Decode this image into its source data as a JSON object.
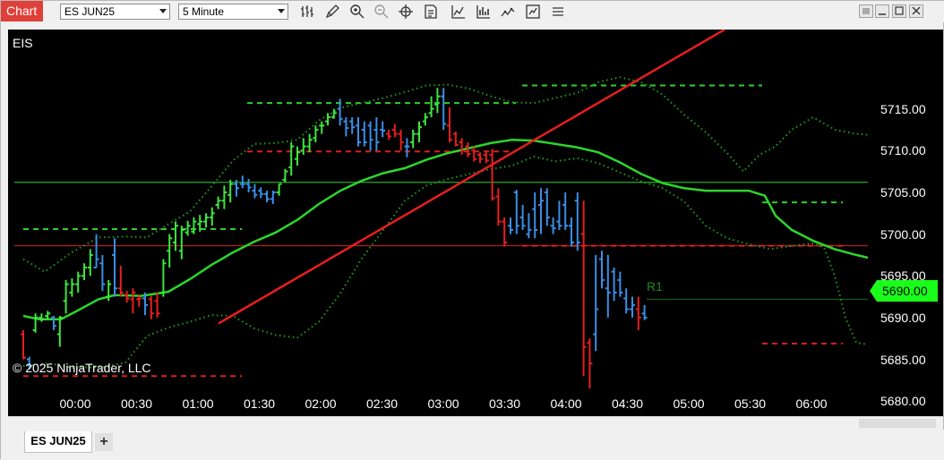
{
  "toolbar": {
    "chart_label": "Chart",
    "instrument_select": "ES JUN25",
    "interval_select": "5 Minute",
    "icons": [
      "bar-style-icon",
      "draw-tool-icon",
      "zoom-in-icon",
      "zoom-out-icon",
      "crosshair-icon",
      "data-box-icon",
      "indicators-icon",
      "strategies-icon",
      "chart-trader-icon",
      "properties-icon",
      "drawing-objects-icon"
    ]
  },
  "window": {
    "buttons": [
      "restore-icon",
      "minimize-icon",
      "maximize-icon",
      "close-icon"
    ]
  },
  "chart": {
    "instrument_label": "EIS",
    "copyright": "© 2025 NinjaTrader, LLC",
    "r1_label": "R1",
    "current_price": "5690.00"
  },
  "colors": {
    "up": "#3de63d",
    "down": "#e61e1e",
    "neutral": "#3a8ee6",
    "sma": "#2cd62c",
    "trendline": "#e61e1e",
    "level_green": "#2bd12b",
    "level_red": "#d92020"
  },
  "tabs": {
    "active": "ES JUN25",
    "add": "+"
  },
  "chart_data": {
    "type": "ohlc",
    "yticks": [
      "5715.00",
      "5710.00",
      "5705.00",
      "5700.00",
      "5695.00",
      "5690.00",
      "5685.00",
      "5680.00"
    ],
    "ytick_values": [
      5715,
      5710,
      5705,
      5700,
      5695,
      5690,
      5685,
      5680
    ],
    "xticks": [
      "00:00",
      "00:30",
      "01:00",
      "01:30",
      "02:00",
      "02:30",
      "03:00",
      "03:30",
      "04:00",
      "04:30",
      "05:00",
      "05:30",
      "06:00"
    ],
    "ylim": [
      5678.2,
      5724.5
    ],
    "xlim": [
      -8.5,
      87.5
    ],
    "bars": [
      [
        5688,
        5688.5,
        5685,
        5685.2,
        "d"
      ],
      [
        5685,
        5685.3,
        5683.8,
        5684.2,
        "n"
      ],
      [
        5688.5,
        5690.5,
        5688.2,
        5690,
        "u"
      ],
      [
        5690,
        5690.5,
        5689.5,
        5689.8,
        "u"
      ],
      [
        5690.2,
        5690.8,
        5689.7,
        5690.5,
        "u"
      ],
      [
        5690,
        5690.2,
        5688.5,
        5689,
        "n"
      ],
      [
        5688,
        5690.2,
        5686.5,
        5690,
        "u"
      ],
      [
        5692,
        5694.5,
        5690.5,
        5694,
        "u"
      ],
      [
        5693,
        5694.7,
        5692.5,
        5694,
        "u"
      ],
      [
        5694,
        5695.5,
        5693,
        5695,
        "u"
      ],
      [
        5695,
        5696.5,
        5694.5,
        5696,
        "u"
      ],
      [
        5696,
        5698.2,
        5695,
        5697.5,
        "u"
      ],
      [
        5696,
        5700,
        5696,
        5697,
        "n"
      ],
      [
        5696.5,
        5697.5,
        5693.2,
        5694,
        "n"
      ],
      [
        5692.5,
        5694.5,
        5692,
        5694,
        "u"
      ],
      [
        5697.5,
        5699.5,
        5692.5,
        5693.5,
        "n"
      ],
      [
        5693.5,
        5696.2,
        5692.5,
        5693,
        "d"
      ],
      [
        5692.7,
        5693.2,
        5691.8,
        5692.3,
        "d"
      ],
      [
        5692.2,
        5693.5,
        5690.5,
        5693,
        "d"
      ],
      [
        5692.2,
        5692.7,
        5691.3,
        5692.3,
        "d"
      ],
      [
        5692.3,
        5693,
        5690.3,
        5691.5,
        "n"
      ],
      [
        5692.2,
        5692.6,
        5689.8,
        5690.5,
        "d"
      ],
      [
        5692,
        5693,
        5690,
        5690.5,
        "d"
      ],
      [
        5693,
        5697,
        5692.5,
        5696.5,
        "u"
      ],
      [
        5698,
        5700,
        5696,
        5699.5,
        "u"
      ],
      [
        5699,
        5701.5,
        5698,
        5701,
        "u"
      ],
      [
        5698,
        5701,
        5697,
        5700.5,
        "u"
      ],
      [
        5700.2,
        5701.6,
        5699.8,
        5701,
        "u"
      ],
      [
        5700.3,
        5702,
        5700,
        5701.5,
        "u"
      ],
      [
        5701.2,
        5702.3,
        5700.3,
        5701.5,
        "u"
      ],
      [
        5701.5,
        5702.5,
        5700.8,
        5702,
        "u"
      ],
      [
        5702,
        5703.2,
        5701,
        5702.5,
        "u"
      ],
      [
        5703.5,
        5704.5,
        5703,
        5704,
        "u"
      ],
      [
        5704,
        5705.8,
        5703,
        5705,
        "u"
      ],
      [
        5704.7,
        5706.5,
        5703.8,
        5706,
        "u"
      ],
      [
        5706,
        5706.5,
        5704.5,
        5705.5,
        "n"
      ],
      [
        5706,
        5707,
        5705.5,
        5706,
        "n"
      ],
      [
        5706,
        5706.6,
        5705,
        5705.6,
        "n"
      ],
      [
        5705.2,
        5706,
        5704.3,
        5704.7,
        "n"
      ],
      [
        5705.2,
        5705.6,
        5704.3,
        5704.8,
        "n"
      ],
      [
        5704.8,
        5705.2,
        5703.8,
        5704.2,
        "n"
      ],
      [
        5704.2,
        5705.2,
        5703.6,
        5705,
        "n"
      ],
      [
        5705,
        5706,
        5704.6,
        5706,
        "u"
      ],
      [
        5706.5,
        5707.8,
        5706.2,
        5707.5,
        "u"
      ],
      [
        5708,
        5711,
        5707,
        5710.5,
        "u"
      ],
      [
        5709,
        5710.5,
        5708.2,
        5709.8,
        "u"
      ],
      [
        5710,
        5711.5,
        5709.5,
        5710.5,
        "u"
      ],
      [
        5710.5,
        5712,
        5709.8,
        5711.3,
        "u"
      ],
      [
        5711.5,
        5713,
        5711,
        5712.5,
        "u"
      ],
      [
        5713,
        5713.5,
        5712,
        5713,
        "u"
      ],
      [
        5713.5,
        5714.5,
        5713,
        5714,
        "u"
      ],
      [
        5714,
        5715,
        5713.8,
        5714.5,
        "u"
      ],
      [
        5715,
        5716.2,
        5713,
        5713.8,
        "n"
      ],
      [
        5713.5,
        5714,
        5711.7,
        5712.7,
        "n"
      ],
      [
        5713.5,
        5714,
        5712,
        5712.8,
        "n"
      ],
      [
        5713,
        5714,
        5710.5,
        5711,
        "n"
      ],
      [
        5712.5,
        5713.5,
        5710.5,
        5711,
        "n"
      ],
      [
        5713,
        5713.5,
        5710,
        5711.3,
        "n"
      ],
      [
        5712.5,
        5714,
        5710,
        5711,
        "n"
      ],
      [
        5712.5,
        5713.5,
        5711.6,
        5712.4,
        "n"
      ],
      [
        5712,
        5712.5,
        5711.3,
        5711.7,
        "d"
      ],
      [
        5712.5,
        5713.2,
        5711.6,
        5712,
        "d"
      ],
      [
        5712,
        5712.5,
        5710,
        5711,
        "d"
      ],
      [
        5710.5,
        5711.5,
        5709.2,
        5710.5,
        "n"
      ],
      [
        5711,
        5712.5,
        5710.3,
        5712,
        "u"
      ],
      [
        5712,
        5713.5,
        5711,
        5712.8,
        "u"
      ],
      [
        5713.5,
        5714.5,
        5713,
        5714,
        "u"
      ],
      [
        5714.5,
        5716.5,
        5714,
        5715,
        "u"
      ],
      [
        5715.5,
        5717.5,
        5714.5,
        5716.5,
        "u"
      ],
      [
        5716.5,
        5717.5,
        5712.5,
        5713.2,
        "n"
      ],
      [
        5713,
        5715.2,
        5711,
        5711.3,
        "d"
      ],
      [
        5712,
        5712.3,
        5710.5,
        5710.7,
        "d"
      ],
      [
        5711,
        5711.5,
        5709.5,
        5710,
        "d"
      ],
      [
        5710.5,
        5711,
        5709.2,
        5709.6,
        "d"
      ],
      [
        5710,
        5710.5,
        5708.7,
        5709,
        "d"
      ],
      [
        5709.5,
        5709.8,
        5708.5,
        5709,
        "d"
      ],
      [
        5709.5,
        5710,
        5708.5,
        5708.8,
        "d"
      ],
      [
        5709.5,
        5710.2,
        5704,
        5704.3,
        "d"
      ],
      [
        5704.5,
        5705.5,
        5701,
        5701.5,
        "d"
      ],
      [
        5701.5,
        5702,
        5698.5,
        5699,
        "d"
      ],
      [
        5701,
        5702,
        5700,
        5700.5,
        "n"
      ],
      [
        5705,
        5705.3,
        5700,
        5701,
        "n"
      ],
      [
        5702,
        5703.5,
        5700.5,
        5701,
        "n"
      ],
      [
        5700,
        5702.5,
        5699.5,
        5700.5,
        "n"
      ],
      [
        5703,
        5705,
        5699.5,
        5700.5,
        "n"
      ],
      [
        5703.5,
        5705.5,
        5700,
        5704,
        "n"
      ],
      [
        5705,
        5705.5,
        5701,
        5702,
        "n"
      ],
      [
        5701,
        5702,
        5700,
        5700.7,
        "n"
      ],
      [
        5701.5,
        5704,
        5700.5,
        5701,
        "n"
      ],
      [
        5703.5,
        5705,
        5700.5,
        5701,
        "n"
      ],
      [
        5701,
        5702,
        5698.5,
        5699,
        "n"
      ],
      [
        5704,
        5705,
        5698,
        5699,
        "n"
      ],
      [
        5700,
        5704,
        5683,
        5686.5,
        "d"
      ],
      [
        5687,
        5687.5,
        5681.5,
        5684.5,
        "d"
      ],
      [
        5688,
        5697.5,
        5686,
        5691,
        "n"
      ],
      [
        5697,
        5698,
        5693.5,
        5694.5,
        "n"
      ],
      [
        5693.5,
        5697.5,
        5690,
        5693,
        "n"
      ],
      [
        5695.5,
        5696,
        5692,
        5693,
        "n"
      ],
      [
        5694.5,
        5695.5,
        5692.5,
        5693,
        "n"
      ],
      [
        5692.3,
        5693.5,
        5690.5,
        5691,
        "n"
      ],
      [
        5691,
        5692.5,
        5690,
        5691.5,
        "n"
      ],
      [
        5691,
        5692.5,
        5688.5,
        5690,
        "d"
      ],
      [
        5690.5,
        5691.5,
        5689.7,
        5690,
        "n"
      ]
    ],
    "sma": [
      [
        0,
        5690.2
      ],
      [
        3,
        5689.8
      ],
      [
        7,
        5689.8
      ],
      [
        10,
        5690.8
      ],
      [
        14,
        5692.2
      ],
      [
        17,
        5692.7
      ],
      [
        22,
        5692.6
      ],
      [
        27,
        5693.1
      ],
      [
        31,
        5694.6
      ],
      [
        35,
        5696.3
      ],
      [
        39,
        5697.8
      ],
      [
        43,
        5699.1
      ],
      [
        47,
        5700.2
      ],
      [
        51,
        5701.7
      ],
      [
        55,
        5703.6
      ],
      [
        59,
        5705.2
      ],
      [
        63,
        5706.4
      ],
      [
        67,
        5707.3
      ],
      [
        71,
        5707.9
      ],
      [
        75,
        5708.9
      ],
      [
        79,
        5709.7
      ],
      [
        83,
        5710.3
      ],
      [
        87,
        5710.9
      ],
      [
        91,
        5711.3
      ],
      [
        95,
        5711.2
      ],
      [
        99,
        5710.8
      ],
      [
        103,
        5710.4
      ],
      [
        107,
        5709.8
      ],
      [
        111,
        5708.6
      ],
      [
        115,
        5707.2
      ],
      [
        119,
        5706.1
      ],
      [
        123,
        5705.5
      ],
      [
        127,
        5705.2
      ],
      [
        131,
        5705.2
      ],
      [
        135,
        5705.2
      ],
      [
        138,
        5704.6
      ],
      [
        140,
        5702.2
      ],
      [
        143,
        5700.5
      ],
      [
        147,
        5699.2
      ],
      [
        151,
        5698.2
      ],
      [
        155,
        5697.5
      ],
      [
        159,
        5696.9
      ]
    ],
    "bb_upper": [
      [
        0,
        5697
      ],
      [
        4,
        5695.5
      ],
      [
        9,
        5697.8
      ],
      [
        14,
        5699.6
      ],
      [
        19,
        5699.7
      ],
      [
        23,
        5699.6
      ],
      [
        27,
        5701.2
      ],
      [
        31,
        5702.7
      ],
      [
        35,
        5705.7
      ],
      [
        39,
        5708.8
      ],
      [
        43,
        5710.8
      ],
      [
        47,
        5710.9
      ],
      [
        51,
        5711.3
      ],
      [
        55,
        5713.6
      ],
      [
        59,
        5715.1
      ],
      [
        63,
        5715.7
      ],
      [
        67,
        5716.3
      ],
      [
        71,
        5717
      ],
      [
        75,
        5717.8
      ],
      [
        79,
        5717.9
      ],
      [
        83,
        5717.4
      ],
      [
        87,
        5716.5
      ],
      [
        91,
        5715.8
      ],
      [
        95,
        5715.7
      ],
      [
        99,
        5716.3
      ],
      [
        103,
        5716.9
      ],
      [
        107,
        5718.2
      ],
      [
        111,
        5718.8
      ],
      [
        115,
        5718.2
      ],
      [
        119,
        5716.7
      ],
      [
        123,
        5714.3
      ],
      [
        127,
        5712.2
      ],
      [
        131,
        5709.7
      ],
      [
        134,
        5707.5
      ],
      [
        137,
        5709.5
      ],
      [
        140,
        5710.5
      ],
      [
        143,
        5712.5
      ],
      [
        147,
        5714
      ],
      [
        151,
        5712.5
      ],
      [
        155,
        5712
      ],
      [
        159,
        5711.8
      ],
      [
        163,
        5711.2
      ],
      [
        167,
        5709.8
      ]
    ],
    "bb_lower": [
      [
        0,
        5684.2
      ],
      [
        5,
        5684.5
      ],
      [
        9,
        5684
      ],
      [
        15,
        5684.1
      ],
      [
        19,
        5684.6
      ],
      [
        23,
        5687.8
      ],
      [
        27,
        5688.8
      ],
      [
        31,
        5689.5
      ],
      [
        35,
        5690.3
      ],
      [
        39,
        5690.2
      ],
      [
        43,
        5688.7
      ],
      [
        47,
        5687.9
      ],
      [
        51,
        5687.6
      ],
      [
        55,
        5689.5
      ],
      [
        59,
        5692.9
      ],
      [
        63,
        5697.1
      ],
      [
        67,
        5700.5
      ],
      [
        71,
        5704
      ],
      [
        75,
        5705.8
      ],
      [
        79,
        5706.6
      ],
      [
        83,
        5707.2
      ],
      [
        87,
        5707.8
      ],
      [
        91,
        5708.2
      ],
      [
        95,
        5709.3
      ],
      [
        99,
        5708.7
      ],
      [
        103,
        5709.1
      ],
      [
        107,
        5708.5
      ],
      [
        111,
        5707.4
      ],
      [
        115,
        5706.3
      ],
      [
        119,
        5705.5
      ],
      [
        123,
        5703.9
      ],
      [
        127,
        5701
      ],
      [
        131,
        5699.5
      ],
      [
        135,
        5698.8
      ],
      [
        139,
        5698.2
      ],
      [
        143,
        5698.6
      ],
      [
        147,
        5698.9
      ],
      [
        149,
        5698.4
      ],
      [
        151,
        5695
      ],
      [
        153,
        5690
      ],
      [
        155,
        5687
      ],
      [
        159,
        5686.6
      ],
      [
        163,
        5685.3
      ],
      [
        167,
        5683.9
      ]
    ]
  },
  "levels": [
    {
      "y": 5683.0,
      "x1": 17,
      "x2": 261,
      "color": "red",
      "dashed": true
    },
    {
      "y": 5700.6,
      "x1": 17,
      "x2": 261,
      "color": "green",
      "dashed": true
    },
    {
      "y": 5709.9,
      "x1": 267,
      "x2": 567,
      "color": "red",
      "dashed": true
    },
    {
      "y": 5715.7,
      "x1": 267,
      "x2": 567,
      "color": "green",
      "dashed": true
    },
    {
      "y": 5717.8,
      "x1": 574,
      "x2": 842,
      "color": "green",
      "dashed": true
    },
    {
      "y": 5698.6,
      "x1": 574,
      "x2": 932,
      "color": "red",
      "dashed": true
    },
    {
      "y": 5703.8,
      "x1": 842,
      "x2": 932,
      "color": "green",
      "dashed": true
    },
    {
      "y": 5686.9,
      "x1": 842,
      "x2": 932,
      "color": "red",
      "dashed": true
    },
    {
      "y": 5706.2,
      "x1": 7,
      "x2": 960,
      "color": "green",
      "dashed": false
    },
    {
      "y": 5698.6,
      "x1": 7,
      "x2": 960,
      "color": "red",
      "dashed": false
    },
    {
      "y": 5692.2,
      "x1": 713,
      "x2": 960,
      "color": "darkgreen",
      "dashed": false
    }
  ],
  "trendline": {
    "x1": 235,
    "y1": 5689.3,
    "x2": 800,
    "y2": 5724.5
  }
}
